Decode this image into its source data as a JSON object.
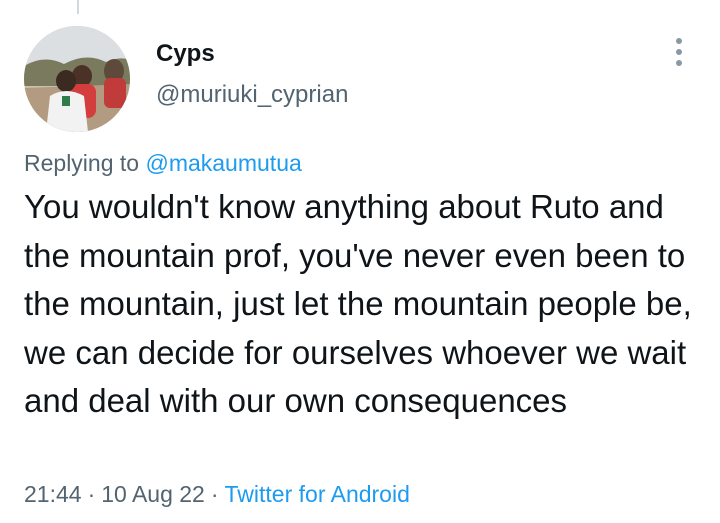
{
  "tweet": {
    "author_name": "Cyps",
    "author_handle": "@muriuki_cyprian",
    "replying_prefix": "Replying to",
    "replying_to": "@makaumutua",
    "text": "You wouldn't know anything about Ruto and the mountain prof, you've never even been to the mountain, just let the mountain people be, we can decide for ourselves whoever we wait and deal with our own consequences",
    "time": "21:44",
    "date": "10 Aug 22",
    "source": "Twitter for Android",
    "separator": "·"
  },
  "icons": {
    "more": "more-vertical-icon"
  },
  "colors": {
    "text": "#0f1419",
    "secondary": "#536471",
    "link": "#1d9bf0"
  }
}
